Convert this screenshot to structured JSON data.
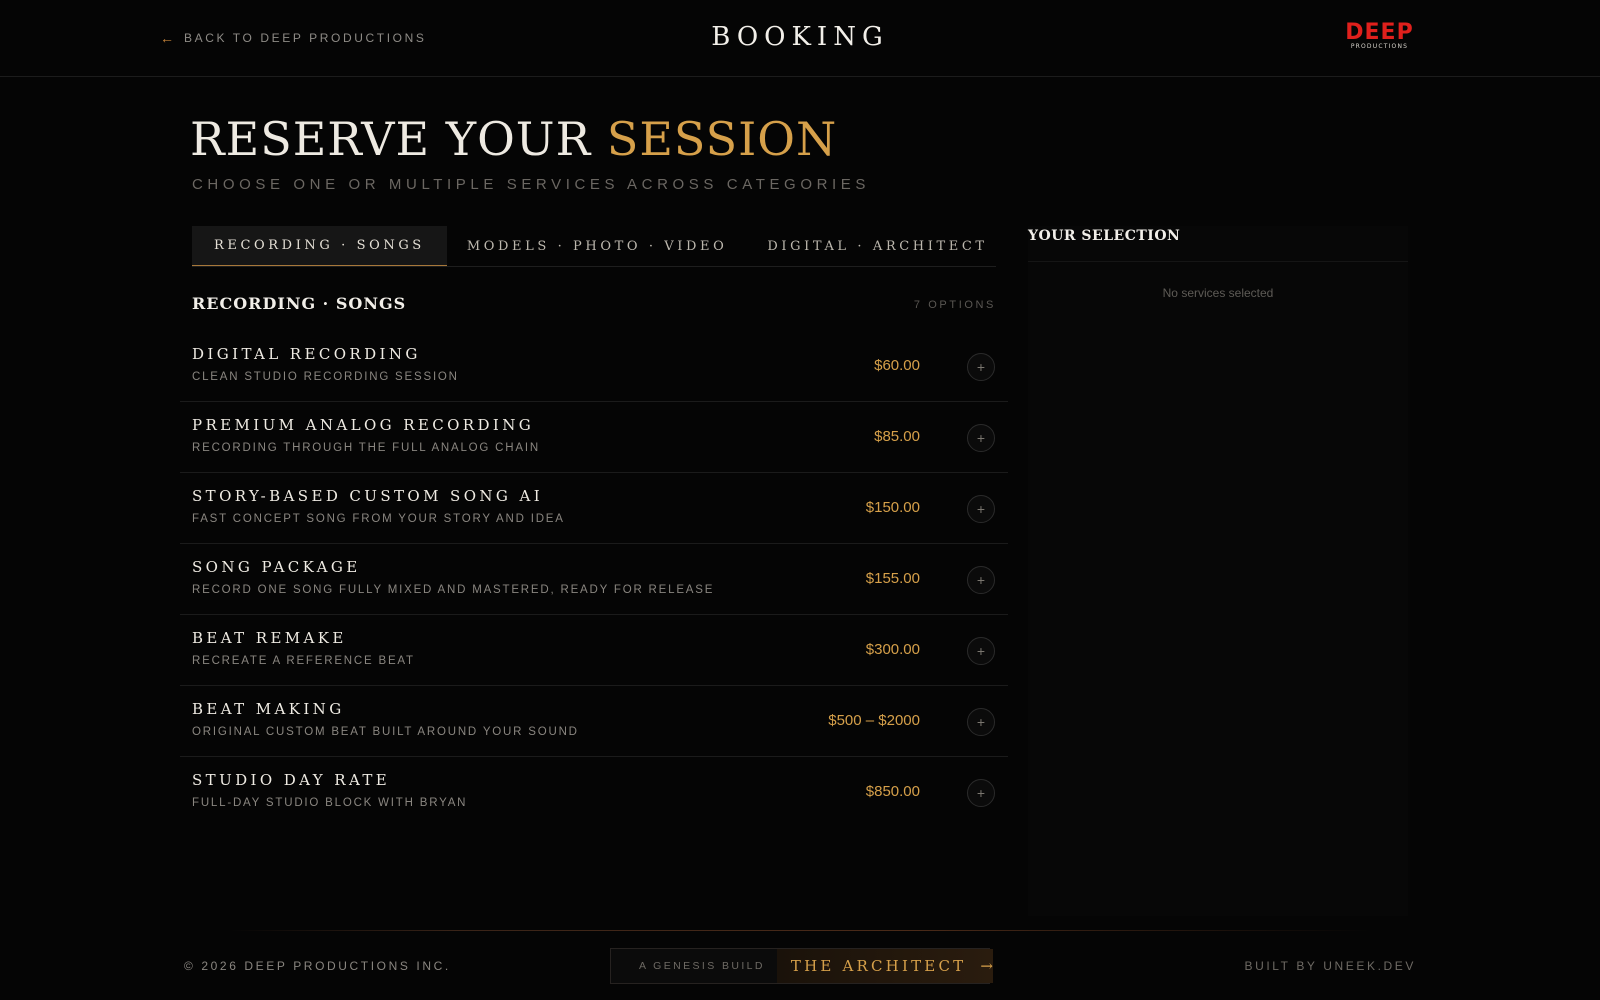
{
  "header": {
    "back_arrow": "←",
    "back_label": "BACK TO DEEP PRODUCTIONS",
    "title": "BOOKING",
    "logo_word": "DEEP",
    "logo_sub": "PRODUCTIONS"
  },
  "hero": {
    "title_main": "RESERVE YOUR ",
    "title_accent": "SESSION",
    "subtitle": "CHOOSE ONE OR MULTIPLE SERVICES ACROSS CATEGORIES"
  },
  "tabs": [
    {
      "label": "RECORDING · SONGS",
      "active": true
    },
    {
      "label": "MODELS · PHOTO · VIDEO",
      "active": false
    },
    {
      "label": "DIGITAL · ARCHITECT",
      "active": false
    }
  ],
  "section": {
    "title": "RECORDING · SONGS",
    "count_label": "7 OPTIONS"
  },
  "services": [
    {
      "name": "DIGITAL RECORDING",
      "desc": "CLEAN STUDIO RECORDING SESSION",
      "price": "$60.00"
    },
    {
      "name": "PREMIUM ANALOG RECORDING",
      "desc": "RECORDING THROUGH THE FULL ANALOG CHAIN",
      "price": "$85.00"
    },
    {
      "name": "STORY-BASED CUSTOM SONG AI",
      "desc": "FAST CONCEPT SONG FROM YOUR STORY AND IDEA",
      "price": "$150.00"
    },
    {
      "name": "SONG PACKAGE",
      "desc": "RECORD ONE SONG FULLY MIXED AND MASTERED, READY FOR RELEASE",
      "price": "$155.00"
    },
    {
      "name": "BEAT REMAKE",
      "desc": "RECREATE A REFERENCE BEAT",
      "price": "$300.00"
    },
    {
      "name": "BEAT MAKING",
      "desc": "ORIGINAL CUSTOM BEAT BUILT AROUND YOUR SOUND",
      "price": "$500 – $2000"
    },
    {
      "name": "STUDIO DAY RATE",
      "desc": "FULL-DAY STUDIO BLOCK WITH BRYAN",
      "price": "$850.00"
    }
  ],
  "add_symbol": "+",
  "selection": {
    "title": "YOUR SELECTION",
    "empty_text": "No services selected"
  },
  "footer": {
    "copyright": "© 2026 DEEP PRODUCTIONS INC.",
    "badge_prefix": "A GENESIS BUILD",
    "badge_link": "THE ARCHITECT",
    "badge_arrow": "→",
    "built_by": "BUILT BY UNEEK.DEV"
  },
  "colors": {
    "background": "#050505",
    "accent_gold": "#d6a04a",
    "logo_red": "#e0201c",
    "muted_text": "#8a8680"
  }
}
